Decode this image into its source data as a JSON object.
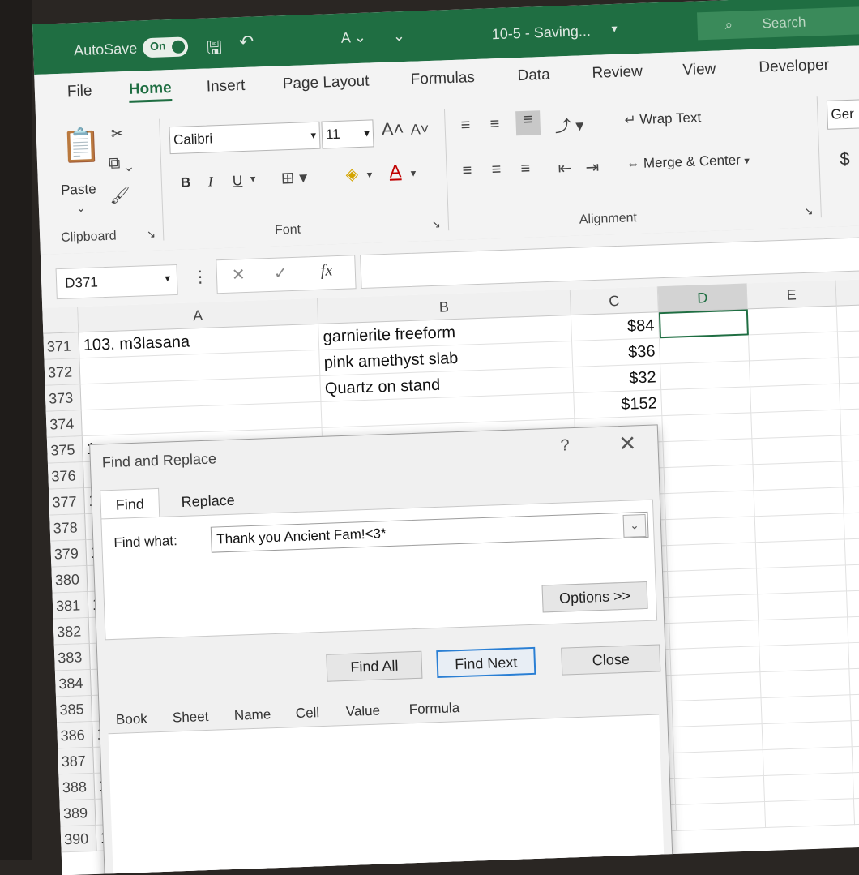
{
  "titlebar": {
    "autosave_label": "AutoSave",
    "autosave_state": "On",
    "doc_title": "10-5 - Saving...",
    "search_placeholder": "Search"
  },
  "tabs": [
    "File",
    "Home",
    "Insert",
    "Page Layout",
    "Formulas",
    "Data",
    "Review",
    "View",
    "Developer"
  ],
  "ribbon": {
    "paste_label": "Paste",
    "clipboard_label": "Clipboard",
    "font_name": "Calibri",
    "font_size": "11",
    "font_label": "Font",
    "bold": "B",
    "italic": "I",
    "underline": "U",
    "wrap_text": "Wrap Text",
    "merge_center": "Merge & Center",
    "alignment_label": "Alignment",
    "number_format": "Ger",
    "currency_symbol": "$"
  },
  "formula_bar": {
    "name_box": "D371",
    "fx": "fx",
    "formula": ""
  },
  "grid": {
    "columns": [
      "A",
      "B",
      "C",
      "D",
      "E"
    ],
    "selected_column": "D",
    "rows": [
      {
        "num": "371",
        "a": "103. m3lasana",
        "b": "garnierite freeform",
        "c": "$84"
      },
      {
        "num": "372",
        "a": "",
        "b": "pink amethyst slab",
        "c": "$36"
      },
      {
        "num": "373",
        "a": "",
        "b": "Quartz on stand",
        "c": "$32"
      },
      {
        "num": "374",
        "a": "",
        "b": "",
        "c": "$152"
      },
      {
        "num": "375",
        "a": "1",
        "b": "",
        "c": ""
      },
      {
        "num": "376",
        "a": "",
        "b": "",
        "c": ""
      },
      {
        "num": "377",
        "a": "1",
        "b": "",
        "c": ""
      },
      {
        "num": "378",
        "a": "",
        "b": "",
        "c": ""
      },
      {
        "num": "379",
        "a": "1",
        "b": "",
        "c": ""
      },
      {
        "num": "380",
        "a": "",
        "b": "",
        "c": ""
      },
      {
        "num": "381",
        "a": "1",
        "b": "",
        "c": ""
      },
      {
        "num": "382",
        "a": "",
        "b": "",
        "c": ""
      },
      {
        "num": "383",
        "a": "",
        "b": "",
        "c": ""
      },
      {
        "num": "384",
        "a": "",
        "b": "",
        "c": ""
      },
      {
        "num": "385",
        "a": "",
        "b": "",
        "c": ""
      },
      {
        "num": "386",
        "a": "1",
        "b": "",
        "c": ""
      },
      {
        "num": "387",
        "a": "",
        "b": "",
        "c": ""
      },
      {
        "num": "388",
        "a": "1",
        "b": "",
        "c": ""
      },
      {
        "num": "389",
        "a": "",
        "b": "",
        "c": ""
      },
      {
        "num": "390",
        "a": "1",
        "b": "",
        "c": ""
      }
    ]
  },
  "dialog": {
    "title": "Find and Replace",
    "help": "?",
    "close_glyph": "✕",
    "tab_find": "Find",
    "tab_replace": "Replace",
    "find_what_label": "Find what:",
    "find_what_value": "Thank you Ancient Fam!<3*",
    "options_button": "Options >>",
    "find_all_button": "Find All",
    "find_next_button": "Find Next",
    "close_button": "Close",
    "result_columns": [
      "Book",
      "Sheet",
      "Name",
      "Cell",
      "Value",
      "Formula"
    ]
  }
}
